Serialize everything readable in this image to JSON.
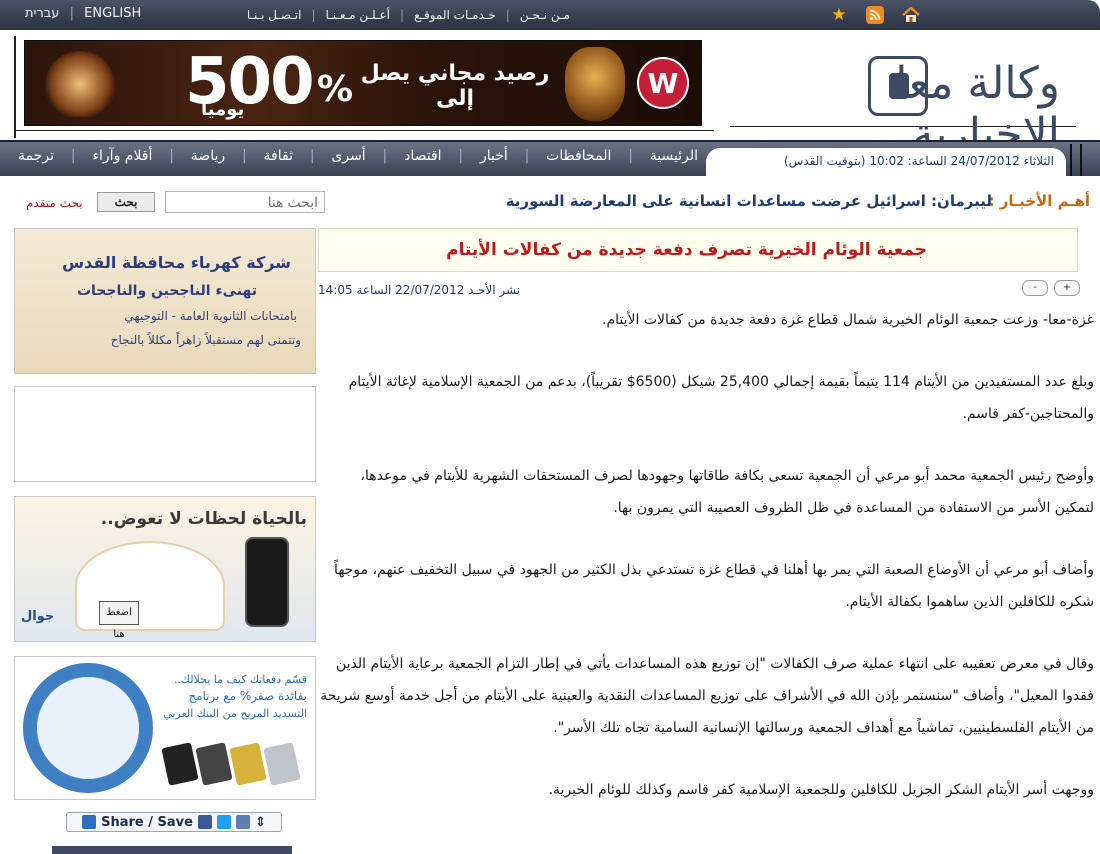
{
  "topbar": {
    "languages": [
      "עברית",
      "ENGLISH"
    ],
    "links": [
      "مـن نـحـن",
      "خـدمـات الموقـع",
      "أعـلـن مـعـنـا",
      "اتـصـل بـنـا"
    ]
  },
  "header": {
    "banner": {
      "headline": "رصيد مجاني يصل إلى",
      "amount": "500",
      "percent": "%",
      "period": "يومياً",
      "brand_mark": "W"
    },
    "logo": {
      "text": "وكالة معا الاخبارية"
    }
  },
  "navbar": {
    "date_line": {
      "day": "الثلاثاء",
      "date": "24/07/2012",
      "time_label": "الساعة:",
      "time": "10:02",
      "timezone": "(بتوقيت القدس)"
    },
    "menu": [
      "الرئيسية",
      "المحافظات",
      "أخبار",
      "اقتصاد",
      "أسرى",
      "ثقافة",
      "رياضة",
      "أقلام وآراء",
      "ترجمة"
    ]
  },
  "ticker": {
    "label": "أهـم الأخبـار :",
    "text": "ليبرمان: اسرائيل عرضت مساعدات انسانية على المعارضة السورية"
  },
  "search": {
    "placeholder": "ابحث هنا",
    "button": "بحث",
    "advanced": "بحث متقدم"
  },
  "ads": {
    "electric": {
      "line1": "شركة كهرباء محافظة القدس",
      "line2": "تهنىء الناجحين والناجحات",
      "line3": "بامتحانات الثانوية العامة - التوجيهي",
      "line4": "وتتمنى لهم مستقبلاً زاهراً مكللاً بالنجاح"
    },
    "jawwal": {
      "tagline": "بالحياة لحظات لا تعوض..",
      "brand": "جوال",
      "press": "اضغط هنا"
    },
    "bank": {
      "line1": "قسّم دفعاتك كيف ما يحلالك..",
      "line2": "بفائدة صفر% مع برنامج",
      "line3": "التسديد المريح من البنك العربي"
    }
  },
  "share": {
    "label": "Share / Save"
  },
  "article": {
    "title": "جمعية الوئام الخيرية تصرف دفعة جديدة من كفالات الأيتام",
    "meta": "نشر الأحـد 22/07/2012 الساعة 14:05",
    "font_buttons": [
      "+",
      "-"
    ],
    "paragraphs": [
      "غزة-معا- وزعت جمعية الوئام الخيرية شمال قطاع غزة دفعة جديدة من كفالات الأيتام.",
      "وبلغ عدد المستفيدين من الأيتام 114 يتيماً بقيمة إجمالي 25,400 شيكل (6500$ تقريباً)، بدعم من الجمعية الإسلامية لإغاثة الأيتام والمحتاجين-كفر قاسم.",
      "وأوضح رئيس الجمعية محمد أبو مرعي أن الجمعية تسعى بكافة طاقاتها وجهودها لصرف المستحقات الشهرية للأيتام في موعدها، لتمكين الأسر من الاستفادة من المساعدة في ظل الظروف العصيبة التي يمرون بها.",
      "وأضاف أبو مرعي أن الأوضاع الصعبة التي يمر بها أهلنا في قطاع غزة تستدعي بذل الكثير من الجهود في سبيل التخفيف عنهم، موجهاً شكره للكافلين الذين ساهموا بكفالة الأيتام.",
      "وقال في معرض تعقيبه على انتهاء عملية صرف الكفالات \"إن توزيع هذه المساعدات يأتي في إطار التزام الجمعية برعاية الأيتام الذين فقدوا المعيل\"، وأضاف \"سنستمر بإذن الله في الأشراف على توزيع المساعدات النقدية والعينية على الأيتام من أجل خدمة أوسع شريحة من الأيتام الفلسطينيين، تماشياً مع أهداف الجمعية ورسالتها الإنسانية السامية تجاه تلك الأسر\".",
      "ووجهت أسر الأيتام الشكر الجزيل للكافلين وللجمعية الإسلامية كفر قاسم وكذلك للوئام الخيرية."
    ]
  },
  "colors": {
    "accent_blue": "#1d3d73",
    "headline_red": "#c0191a",
    "ticker_orange": "#c66a12",
    "nav_dark": "#3a4152"
  }
}
